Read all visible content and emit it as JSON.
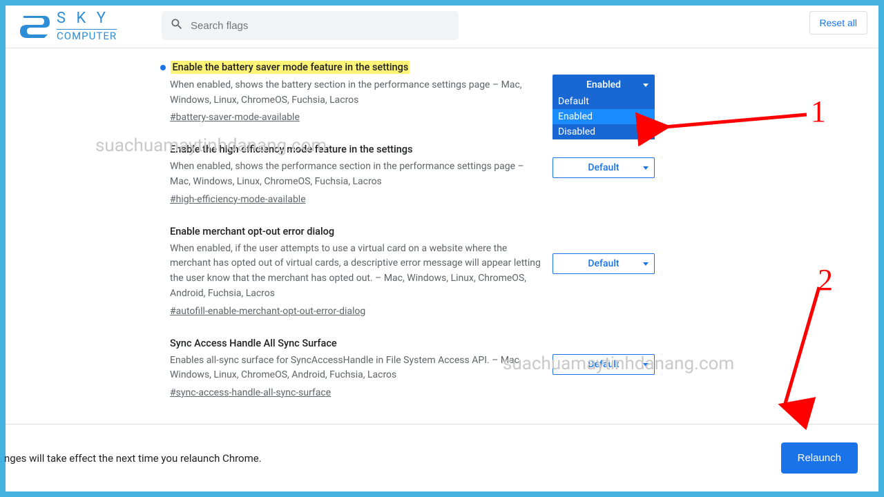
{
  "logo": {
    "top": "S K Y",
    "bottom": "COMPUTER"
  },
  "search": {
    "placeholder": "Search flags"
  },
  "reset": "Reset all",
  "dropdown": {
    "opt0": "Default",
    "opt1": "Enabled",
    "opt2": "Disabled"
  },
  "flags": [
    {
      "title": "Enable the battery saver mode feature in the settings",
      "desc": "When enabled, shows the battery section in the performance settings page – Mac, Windows, Linux, ChromeOS, Fuchsia, Lacros",
      "hash": "#battery-saver-mode-available",
      "value": "Enabled"
    },
    {
      "title": "Enable the high efficiency mode feature in the settings",
      "desc": "When enabled, shows the performance section in the performance settings page – Mac, Windows, Linux, ChromeOS, Fuchsia, Lacros",
      "hash": "#high-efficiency-mode-available",
      "value": "Default"
    },
    {
      "title": "Enable merchant opt-out error dialog",
      "desc": "When enabled, if the user attempts to use a virtual card on a website where the merchant has opted out of virtual cards, a descriptive error message will appear letting the user know that the merchant has opted out. – Mac, Windows, Linux, ChromeOS, Android, Fuchsia, Lacros",
      "hash": "#autofill-enable-merchant-opt-out-error-dialog",
      "value": "Default"
    },
    {
      "title": "Sync Access Handle All Sync Surface",
      "desc": "Enables all-sync surface for SyncAccessHandle in File System Access API. – Mac, Windows, Linux, ChromeOS, Android, Fuchsia, Lacros",
      "hash": "#sync-access-handle-all-sync-surface",
      "value": "Default"
    }
  ],
  "footer": {
    "text": "nges will take effect the next time you relaunch Chrome.",
    "button": "Relaunch"
  },
  "watermark": "suachuamaytinhdanang.com",
  "annot": {
    "one": "1",
    "two": "2"
  }
}
